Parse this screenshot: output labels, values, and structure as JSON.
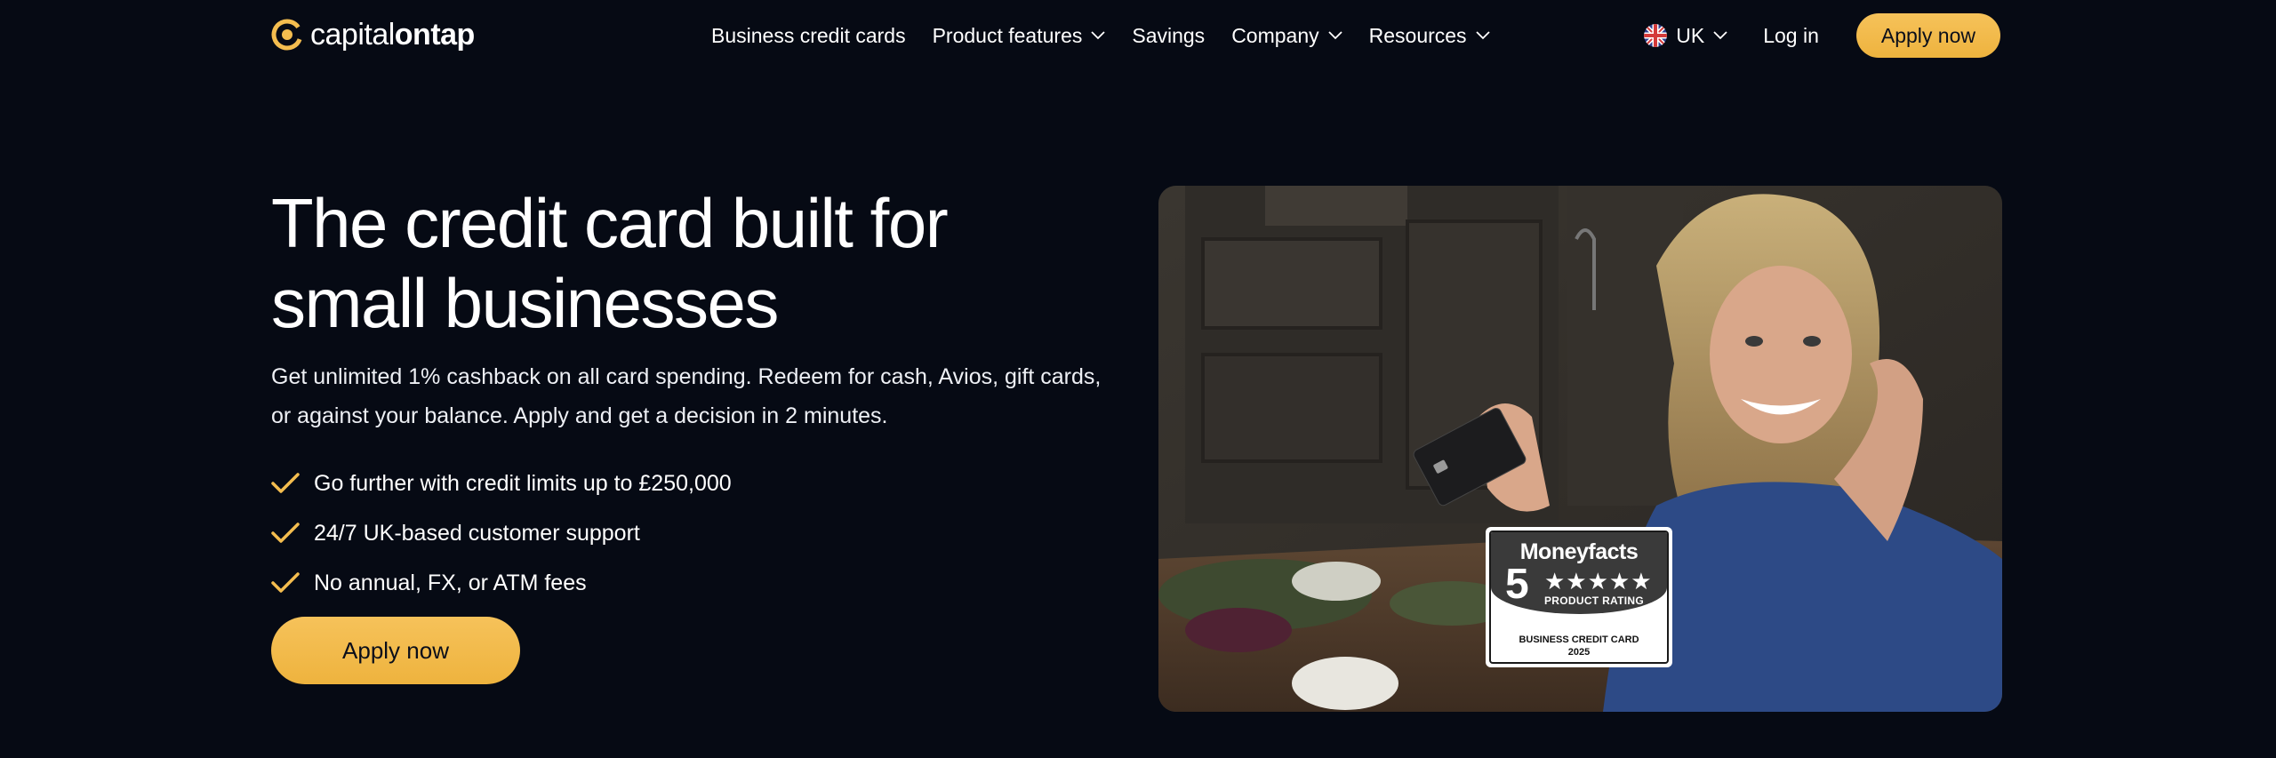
{
  "brand": {
    "logo_light": "capital",
    "logo_bold": "ontap",
    "accent_color": "#f4bd4f"
  },
  "nav": {
    "items": [
      {
        "label": "Business credit cards",
        "has_dropdown": false
      },
      {
        "label": "Product features",
        "has_dropdown": true
      },
      {
        "label": "Savings",
        "has_dropdown": false
      },
      {
        "label": "Company",
        "has_dropdown": true
      },
      {
        "label": "Resources",
        "has_dropdown": true
      }
    ],
    "locale": "UK",
    "login": "Log in",
    "apply": "Apply now"
  },
  "hero": {
    "title_line1": "The credit card built for",
    "title_line2": "small businesses",
    "subtitle": "Get unlimited 1% cashback on all card spending. Redeem for cash, Avios, gift cards, or against your balance. Apply and get a decision in 2 minutes.",
    "features": [
      "Go further with credit limits up to £250,000",
      "24/7 UK-based customer support",
      "No annual, FX, or ATM fees"
    ],
    "cta": "Apply now"
  },
  "badge": {
    "brand": "Moneyfacts",
    "number": "5",
    "stars": "★★★★★",
    "rating_label": "PRODUCT RATING",
    "category": "BUSINESS CREDIT CARD",
    "year": "2025"
  }
}
